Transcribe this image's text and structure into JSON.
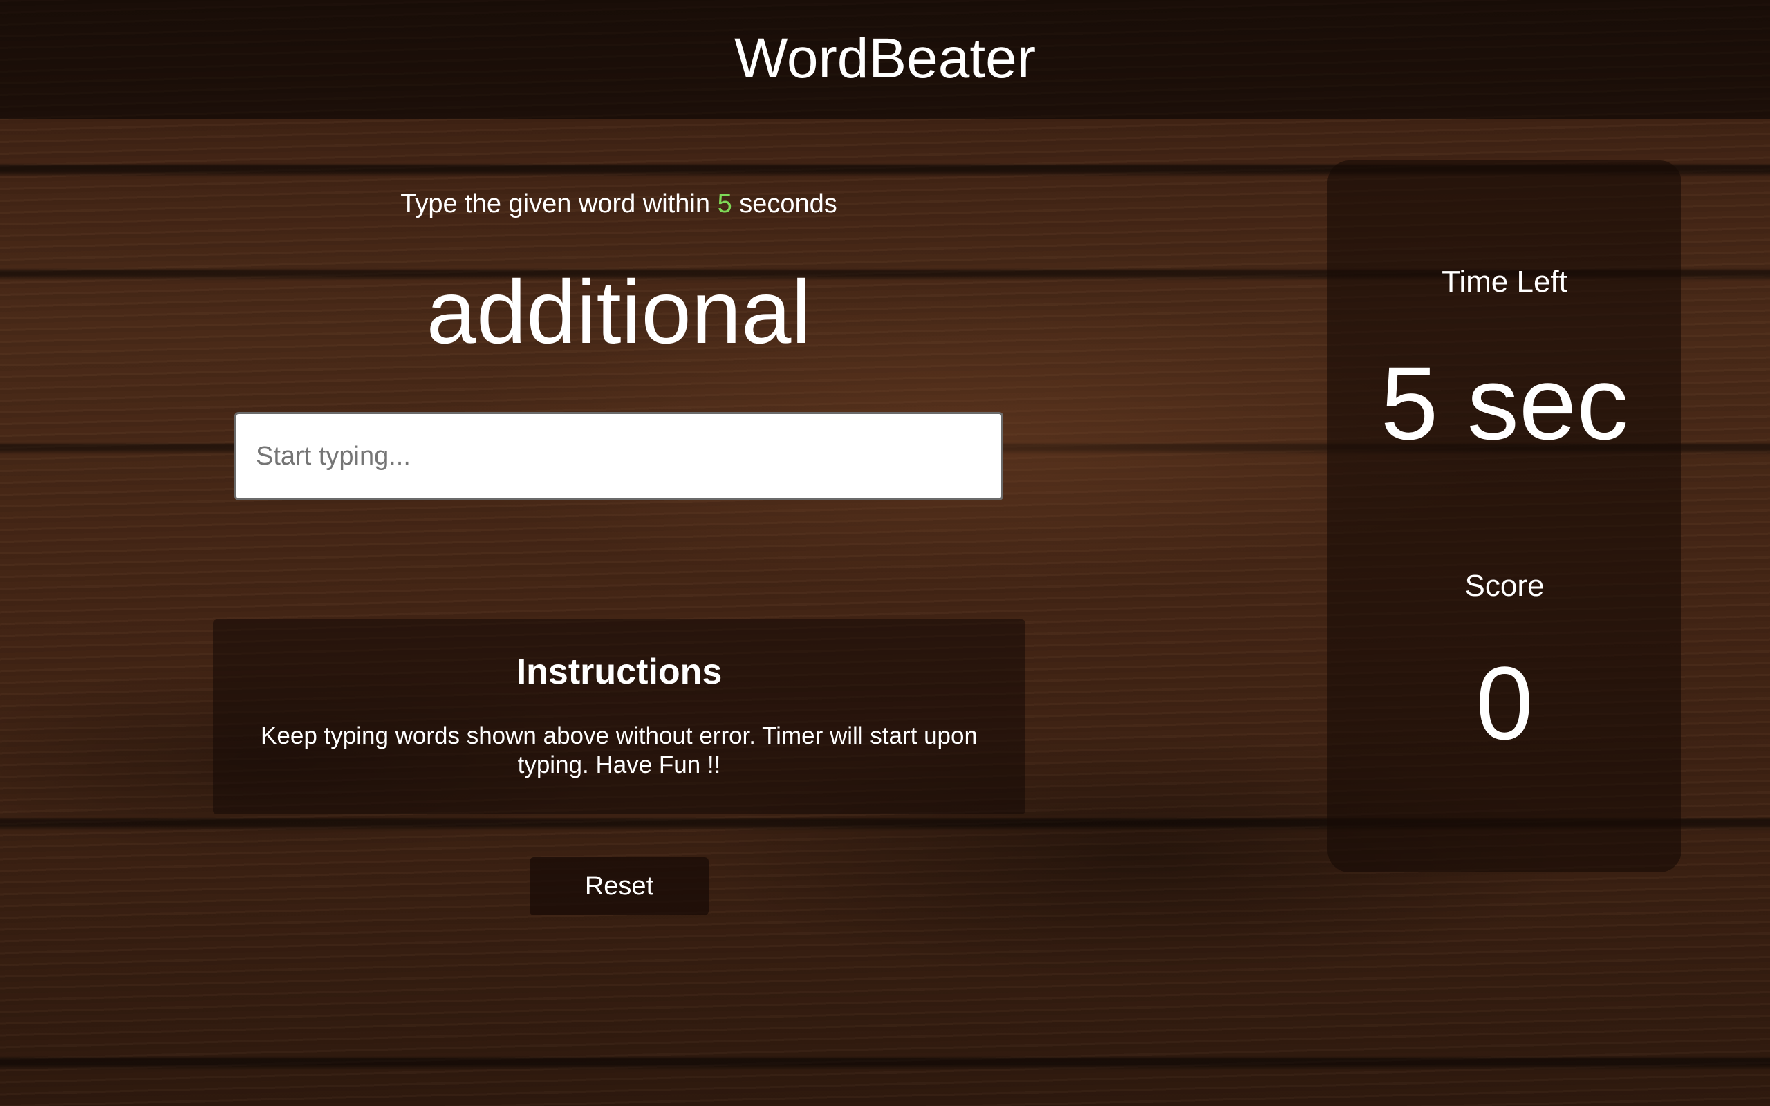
{
  "header": {
    "title": "WordBeater"
  },
  "game": {
    "prompt_prefix": "Type the given word within ",
    "prompt_seconds": "5",
    "prompt_suffix": " seconds",
    "current_word": "additional",
    "input": {
      "value": "",
      "placeholder": "Start typing..."
    }
  },
  "instructions": {
    "heading": "Instructions",
    "text": "Keep typing words shown above without error. Timer will start upon typing. Have Fun !!"
  },
  "controls": {
    "reset_label": "Reset"
  },
  "stats": {
    "time_label": "Time Left",
    "time_value": "5 sec",
    "score_label": "Score",
    "score_value": "0"
  },
  "colors": {
    "accent_seconds": "#7ed957",
    "text": "#ffffff"
  }
}
